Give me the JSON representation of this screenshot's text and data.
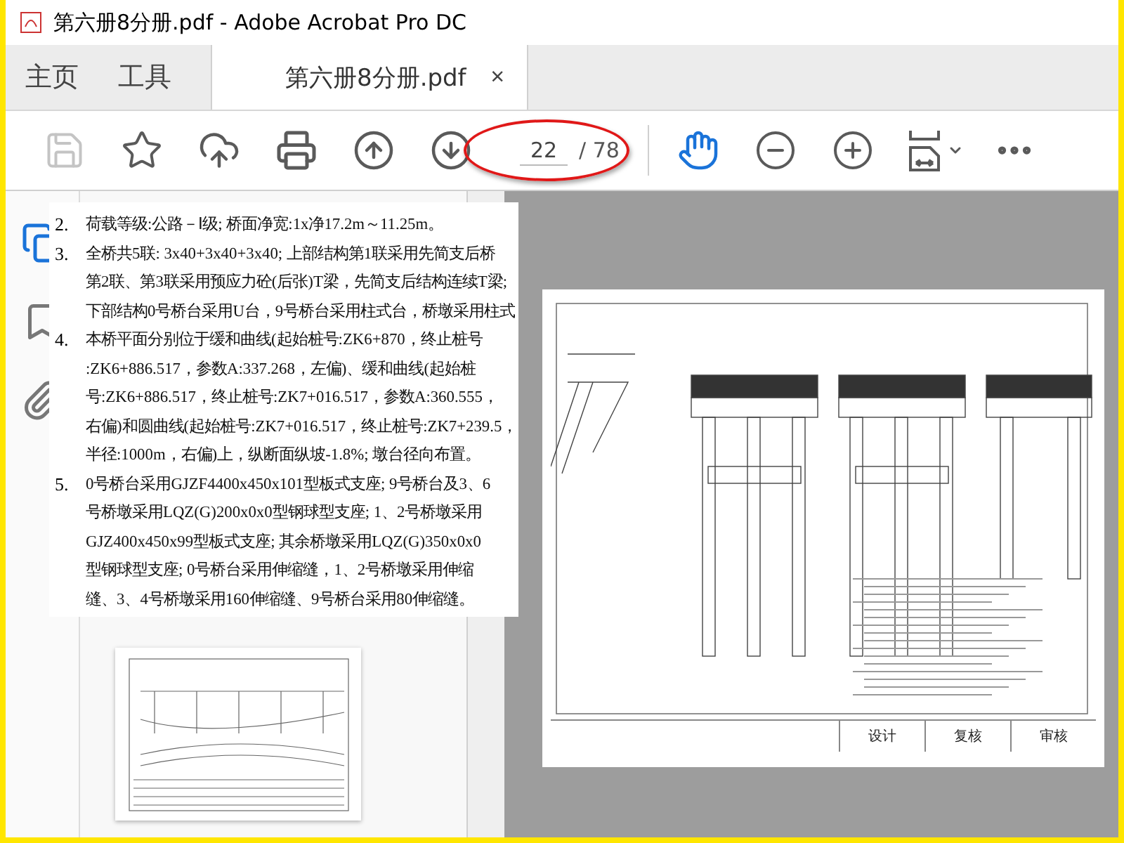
{
  "window": {
    "title": "第六册8分册.pdf - Adobe Acrobat Pro DC"
  },
  "nav_tabs": [
    {
      "label": "主页",
      "selected": false
    },
    {
      "label": "工具",
      "selected": false
    }
  ],
  "document_tab": {
    "label": "第六册8分册.pdf",
    "close": "×",
    "selected": true
  },
  "toolbar": {
    "save_disabled": true,
    "page_number": "22",
    "page_count": "/ 78",
    "page_circled": true
  },
  "notes": [
    {
      "number": "2.",
      "lines": [
        "荷载等级:公路－Ⅰ级; 桥面净宽:1x净17.2m～11.25m。"
      ]
    },
    {
      "number": "3.",
      "lines": [
        "全桥共5联: 3x40+3x40+3x40; 上部结构第1联采用先简支后桥",
        "第2联、第3联采用预应力砼(后张)T梁，先简支后结构连续T梁;",
        "下部结构0号桥台采用U台，9号桥台采用柱式台，桥墩采用柱式"
      ]
    },
    {
      "number": "4.",
      "lines": [
        "本桥平面分别位于缓和曲线(起始桩号:ZK6+870，终止桩号",
        ":ZK6+886.517，参数A:337.268，左偏)、缓和曲线(起始桩",
        "号:ZK6+886.517，终止桩号:ZK7+016.517，参数A:360.555，",
        "右偏)和圆曲线(起始桩号:ZK7+016.517，终止桩号:ZK7+239.5，",
        "半径:1000m，右偏)上，纵断面纵坡-1.8%; 墩台径向布置。"
      ]
    },
    {
      "number": "5.",
      "lines": [
        "0号桥台采用GJZF4400x450x101型板式支座; 9号桥台及3、6",
        "号桥墩采用LQZ(G)200x0x0型钢球型支座; 1、2号桥墩采用",
        "GJZ400x450x99型板式支座; 其余桥墩采用LQZ(G)350x0x0",
        "型钢球型支座; 0号桥台采用伸缩缝，1、2号桥墩采用伸缩",
        "缝、3、4号桥墩采用160伸缩缝、9号桥台采用80伸缩缝。"
      ]
    }
  ],
  "document_page": {
    "title_block": [
      "设计",
      "复核",
      "审核"
    ]
  }
}
